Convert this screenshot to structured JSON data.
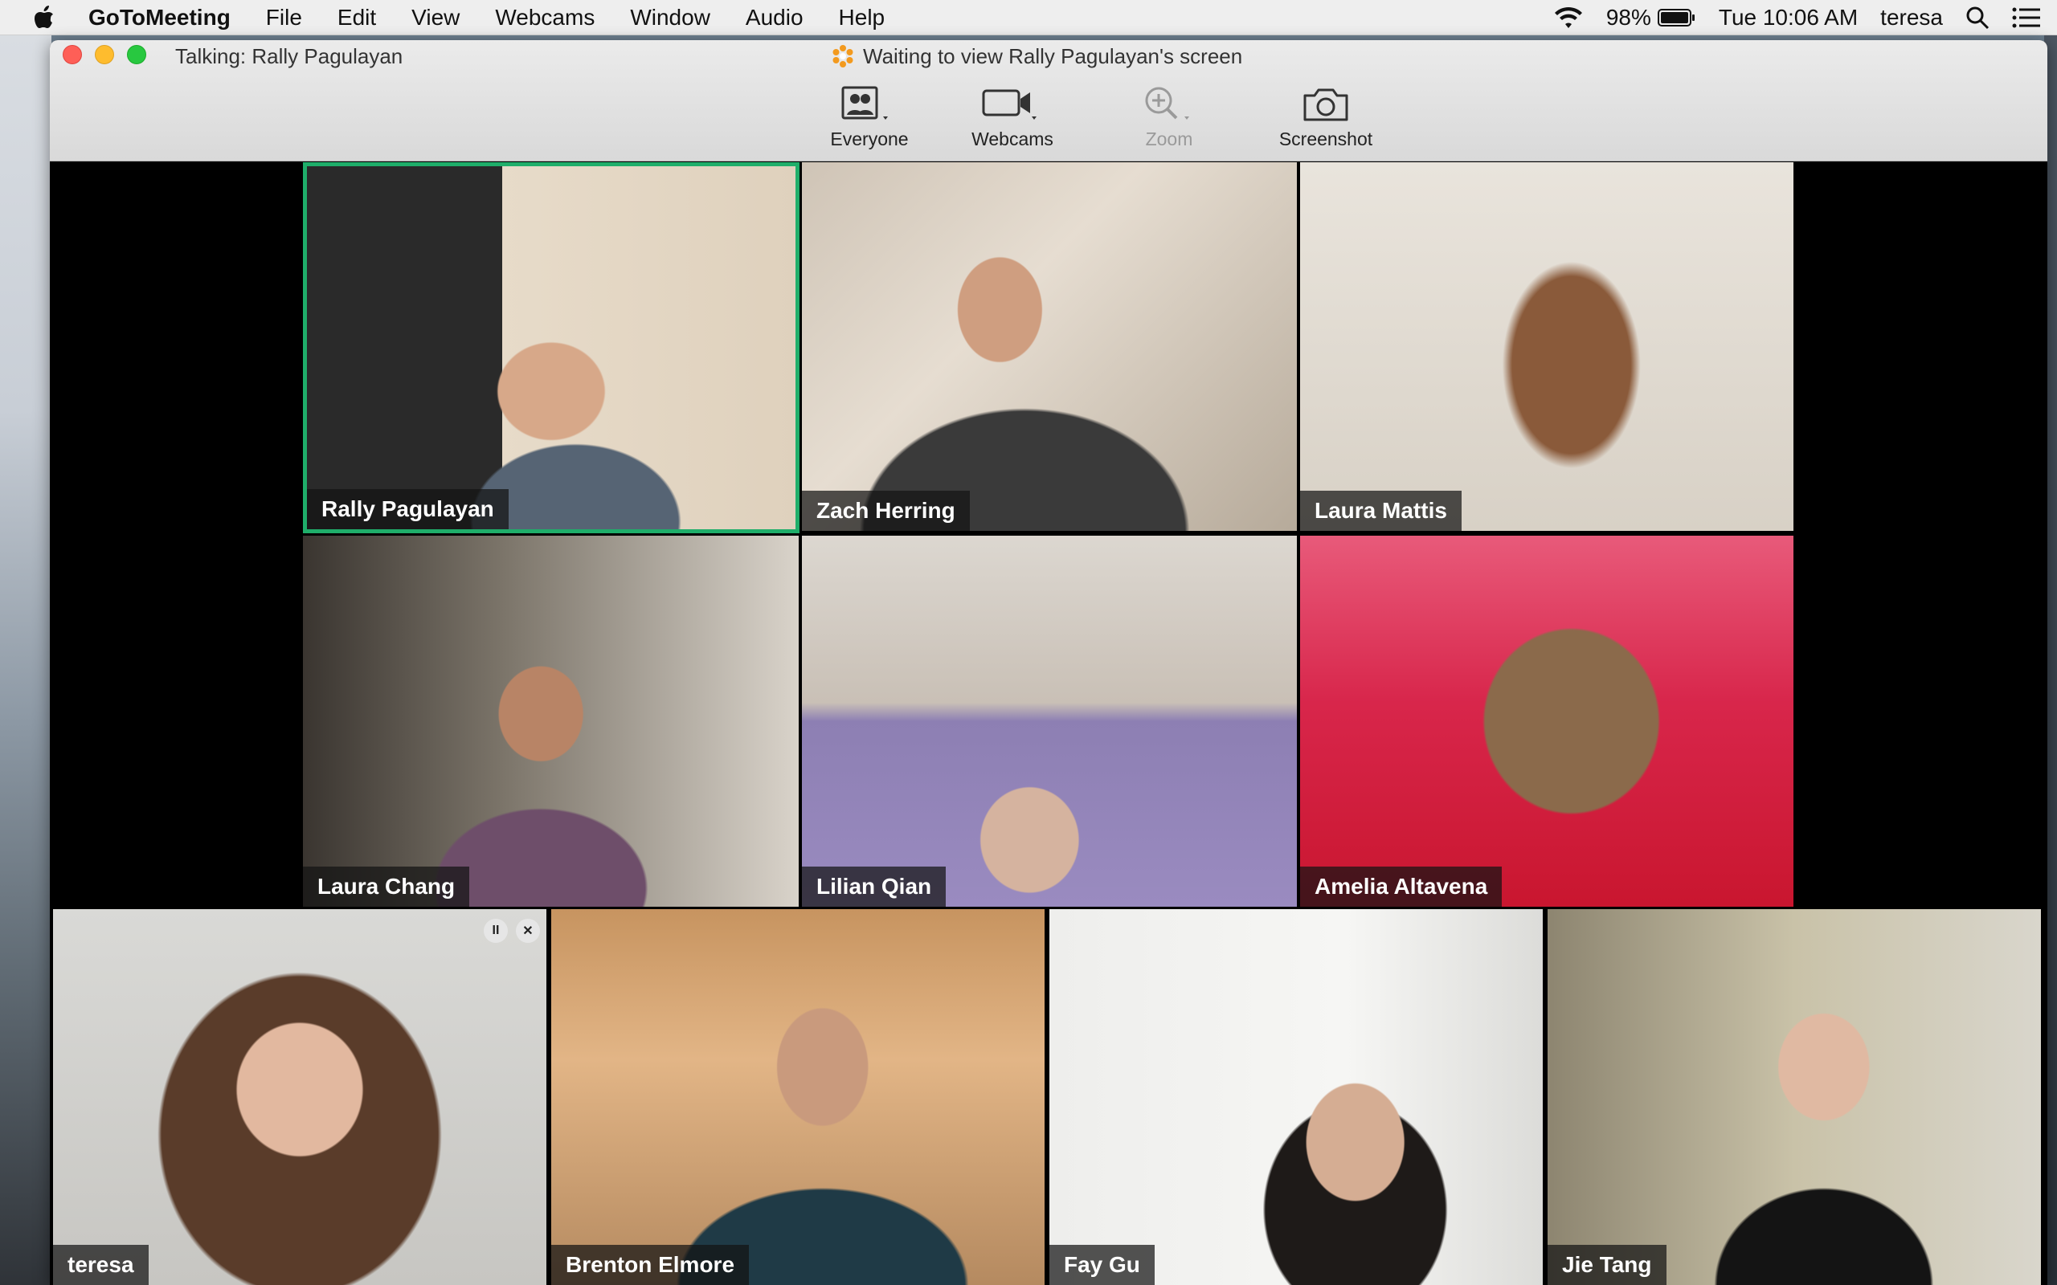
{
  "menubar": {
    "app_name": "GoToMeeting",
    "items": [
      "File",
      "Edit",
      "View",
      "Webcams",
      "Window",
      "Audio",
      "Help"
    ],
    "battery": "98%",
    "clock": "Tue 10:06 AM",
    "user": "teresa",
    "icons": [
      "apple-icon",
      "wifi-icon",
      "battery-icon",
      "spotlight-search-icon",
      "notification-center-icon"
    ]
  },
  "window": {
    "talking": "Talking: Rally Pagulayan",
    "status": "Waiting to view Rally Pagulayan's screen"
  },
  "toolbar": {
    "everyone": "Everyone",
    "webcams": "Webcams",
    "zoom": "Zoom",
    "screenshot": "Screenshot"
  },
  "participants": [
    "Rally Pagulayan",
    "Zach Herring",
    "Laura Mattis",
    "Laura Chang",
    "Lilian Qian",
    "Amelia Altavena",
    "teresa",
    "Brenton Elmore",
    "Fay Gu",
    "Jie Tang"
  ],
  "active_speaker_color": "#1fae6a",
  "self_view_controls": {
    "pause": "II",
    "close": "✕"
  }
}
